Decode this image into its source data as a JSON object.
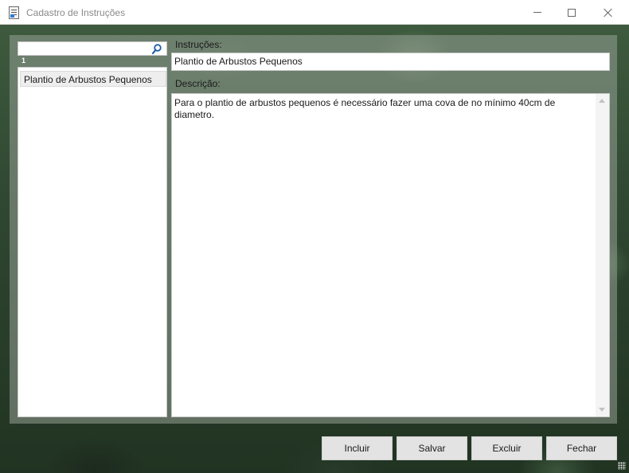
{
  "window": {
    "title": "Cadastro de Instruções",
    "controls": {
      "minimize": "minimize",
      "maximize": "maximize",
      "close": "close"
    }
  },
  "list": {
    "search_value": "",
    "count": "1",
    "items": [
      {
        "label": "Plantio de Arbustos Pequenos"
      }
    ]
  },
  "form": {
    "instrucoes_label": "Instruções:",
    "instrucoes_value": "Plantio de Arbustos Pequenos",
    "descricao_label": "Descrição:",
    "descricao_value": "Para o plantio de arbustos pequenos é necessário fazer uma cova de no mínimo 40cm de diametro."
  },
  "buttons": {
    "incluir": "Incluir",
    "salvar": "Salvar",
    "excluir": "Excluir",
    "fechar": "Fechar"
  },
  "icons": {
    "app": "document-icon",
    "search": "search-icon"
  }
}
